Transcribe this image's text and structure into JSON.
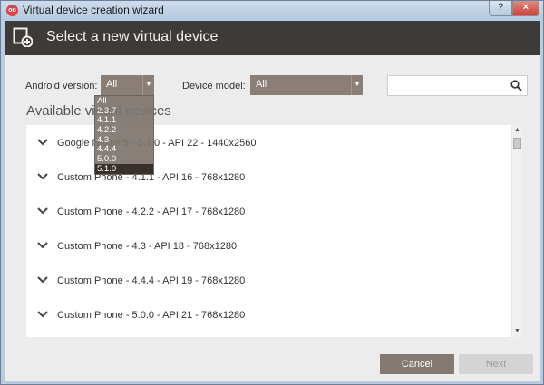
{
  "window": {
    "title": "Virtual device creation wizard",
    "help_label": "?",
    "close_label": "×",
    "app_icon_text": "oo"
  },
  "header": {
    "title": "Select a new virtual device"
  },
  "filters": {
    "android_version_label": "Android version:",
    "android_version_value": "All",
    "device_model_label": "Device model:",
    "device_model_value": "All",
    "search_placeholder": ""
  },
  "dropdown": {
    "options": [
      "All",
      "2.3.7",
      "4.1.1",
      "4.2.2",
      "4.3",
      "4.4.4",
      "5.0.0",
      "5.1.0"
    ],
    "selected": "5.1.0"
  },
  "section_title": "Available virtual devices",
  "devices": [
    "Google Nexus 5 - 5.1.0 - API 22 - 1440x2560",
    "Custom Phone - 4.1.1 - API 16 - 768x1280",
    "Custom Phone - 4.2.2 - API 17 - 768x1280",
    "Custom Phone - 4.3 - API 18 - 768x1280",
    "Custom Phone - 4.4.4 - API 19 - 768x1280",
    "Custom Phone - 5.0.0 - API 21 - 768x1280"
  ],
  "buttons": {
    "cancel": "Cancel",
    "next": "Next"
  },
  "icons": {
    "header": "add-device-icon",
    "search": "search-icon",
    "expand": "chevron-down-icon"
  },
  "colors": {
    "header_bg": "#3e3a37",
    "accent_select": "#8a7e76",
    "dropdown_selected": "#3a302b"
  }
}
